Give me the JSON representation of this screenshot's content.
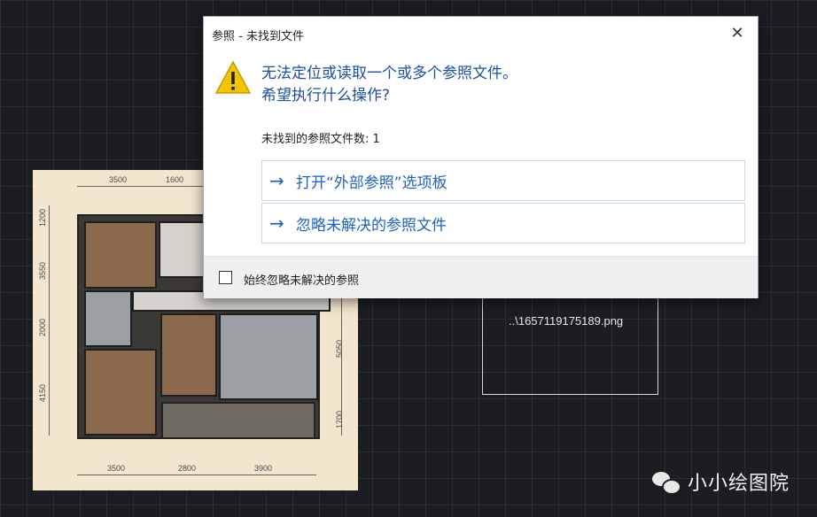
{
  "background": {
    "reference_label": "..\\1657119175189.png"
  },
  "floorplan": {
    "top_dims": [
      "3500",
      "1600"
    ],
    "bottom_dims": [
      "3500",
      "2800",
      "3900"
    ],
    "left_dims": [
      "1200",
      "3550",
      "2000",
      "4150"
    ],
    "right_dims": [
      "5050",
      "1700"
    ]
  },
  "dialog": {
    "title": "参照 - 未找到文件",
    "close_icon": "close-icon",
    "warning_icon": "warning-icon",
    "message_line1": "无法定位或读取一个或多个参照文件。",
    "message_line2": "希望执行什么操作?",
    "missing_count": "未找到的参照文件数: 1",
    "commands": [
      {
        "icon": "arrow-right-icon",
        "label": "打开“外部参照”选项板"
      },
      {
        "icon": "arrow-right-icon",
        "label": "忽略未解决的参照文件"
      }
    ],
    "checkbox_label": "始终忽略未解决的参照",
    "checkbox_checked": false
  },
  "watermark": {
    "text": "小小绘图院"
  },
  "colors": {
    "accent": "#1d62c0",
    "canvas": "#1b1d21",
    "warning": "#f5c400"
  }
}
